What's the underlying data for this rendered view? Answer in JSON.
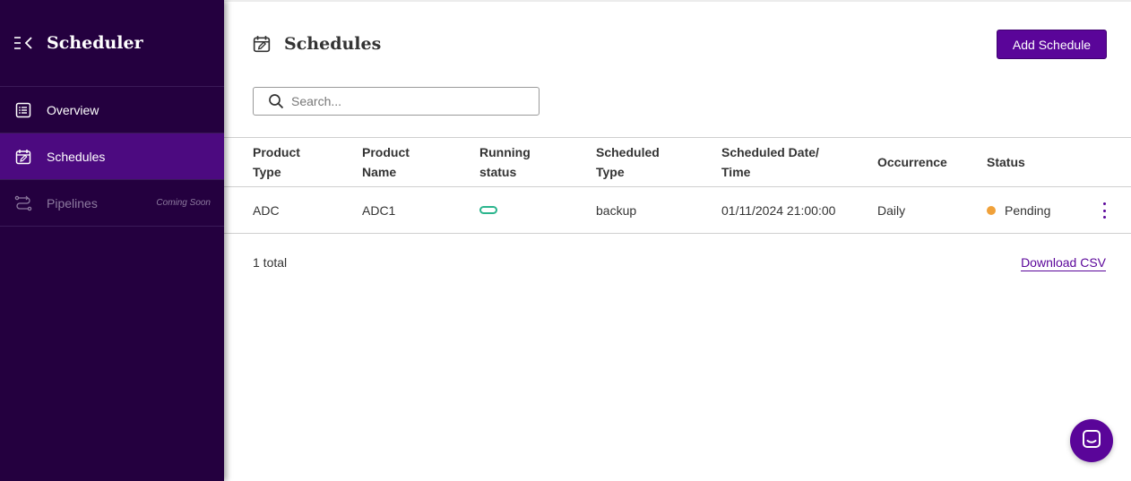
{
  "sidebar": {
    "title": "Scheduler",
    "toggle_icon": "collapse-menu-icon",
    "items": [
      {
        "label": "Overview",
        "icon": "list-icon",
        "state": "normal"
      },
      {
        "label": "Schedules",
        "icon": "calendar-edit-icon",
        "state": "active"
      },
      {
        "label": "Pipelines",
        "icon": "pipeline-icon",
        "state": "disabled",
        "badge": "Coming Soon"
      }
    ]
  },
  "header": {
    "title": "Schedules",
    "icon": "calendar-edit-icon",
    "add_button_label": "Add Schedule"
  },
  "search": {
    "placeholder": "Search...",
    "value": ""
  },
  "table": {
    "columns": [
      {
        "line1": "Product",
        "line2": "Type"
      },
      {
        "line1": "Product",
        "line2": "Name"
      },
      {
        "line1": "Running",
        "line2": "status"
      },
      {
        "line1": "Scheduled",
        "line2": "Type"
      },
      {
        "line1": "Scheduled Date/",
        "line2": "Time"
      },
      {
        "line1": "Occurrence",
        "line2": ""
      },
      {
        "line1": "Status",
        "line2": ""
      }
    ],
    "rows": [
      {
        "product_type": "ADC",
        "product_name": "ADC1",
        "running_status": "toggle-pill-icon",
        "scheduled_type": "backup",
        "scheduled_datetime": "01/11/2024 21:00:00",
        "occurrence": "Daily",
        "status": "Pending",
        "status_color": "#f0a13a"
      }
    ]
  },
  "footer": {
    "total_label": "1 total",
    "download_label": "Download CSV"
  },
  "colors": {
    "sidebar_bg": "#24003f",
    "sidebar_active": "#4c0a80",
    "accent": "#5a0599",
    "running_green": "#2bb58d"
  }
}
